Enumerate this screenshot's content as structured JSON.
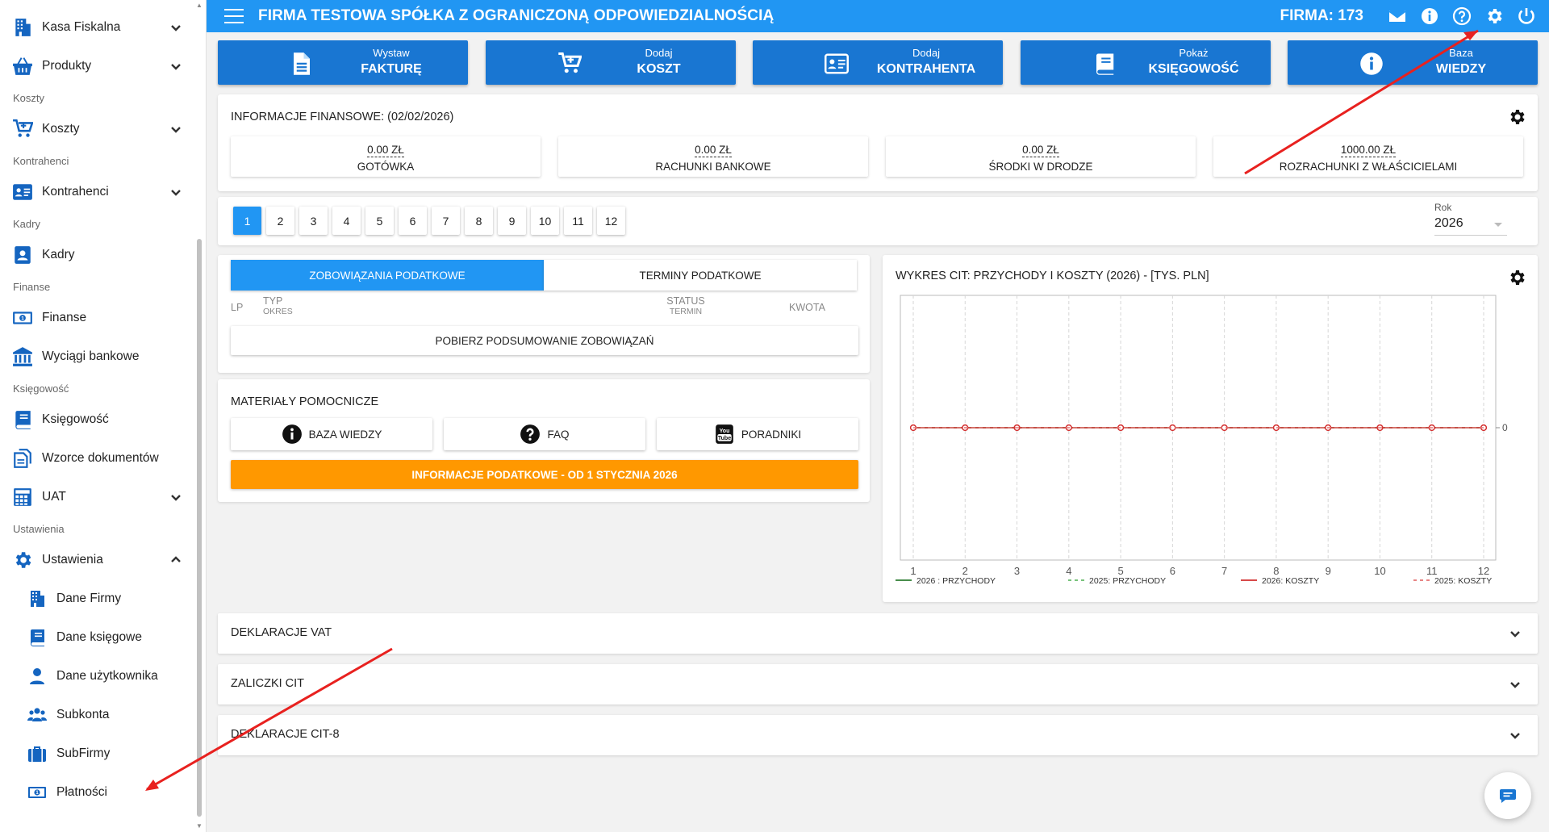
{
  "sidebar": {
    "items": [
      {
        "type": "item",
        "label": "Kasa Fiskalna",
        "icon": "building-icon",
        "chevron": "down"
      },
      {
        "type": "item",
        "label": "Produkty",
        "icon": "basket-icon",
        "chevron": "down"
      },
      {
        "type": "section",
        "label": "Koszty"
      },
      {
        "type": "item",
        "label": "Koszty",
        "icon": "cart-plus-icon",
        "chevron": "down"
      },
      {
        "type": "section",
        "label": "Kontrahenci"
      },
      {
        "type": "item",
        "label": "Kontrahenci",
        "icon": "id-card-icon",
        "chevron": "down"
      },
      {
        "type": "section",
        "label": "Kadry"
      },
      {
        "type": "item",
        "label": "Kadry",
        "icon": "user-badge-icon",
        "chevron": ""
      },
      {
        "type": "section",
        "label": "Finanse"
      },
      {
        "type": "item",
        "label": "Finanse",
        "icon": "money-bill-icon",
        "chevron": ""
      },
      {
        "type": "item",
        "label": "Wyciągi bankowe",
        "icon": "bank-icon",
        "chevron": ""
      },
      {
        "type": "section",
        "label": "Księgowość"
      },
      {
        "type": "item",
        "label": "Księgowość",
        "icon": "book-icon",
        "chevron": ""
      },
      {
        "type": "item",
        "label": "Wzorce dokumentów",
        "icon": "documents-icon",
        "chevron": ""
      },
      {
        "type": "item",
        "label": "UAT",
        "icon": "calculator-icon",
        "chevron": "down"
      },
      {
        "type": "section",
        "label": "Ustawienia"
      },
      {
        "type": "item",
        "label": "Ustawienia",
        "icon": "gear-icon",
        "chevron": "up"
      },
      {
        "type": "sub",
        "label": "Dane Firmy",
        "icon": "building-icon"
      },
      {
        "type": "sub",
        "label": "Dane księgowe",
        "icon": "book-icon"
      },
      {
        "type": "sub",
        "label": "Dane użytkownika",
        "icon": "user-icon"
      },
      {
        "type": "sub",
        "label": "Subkonta",
        "icon": "users-icon"
      },
      {
        "type": "sub",
        "label": "SubFirmy",
        "icon": "briefcase-icon"
      },
      {
        "type": "sub",
        "label": "Płatności",
        "icon": "money-bill-icon"
      }
    ]
  },
  "topbar": {
    "title": "FIRMA TESTOWA SPÓŁKA Z OGRANICZONĄ ODPOWIEDZIALNOŚCIĄ",
    "firma": "FIRMA: 173",
    "icons": [
      "envelope-icon",
      "info-icon",
      "help-icon",
      "gear-icon",
      "power-icon"
    ]
  },
  "actions": [
    {
      "small": "Wystaw",
      "big": "FAKTURĘ",
      "icon": "file-icon"
    },
    {
      "small": "Dodaj",
      "big": "KOSZT",
      "icon": "cart-plus-icon"
    },
    {
      "small": "Dodaj",
      "big": "KONTRAHENTA",
      "icon": "id-card-icon"
    },
    {
      "small": "Pokaż",
      "big": "KSIĘGOWOŚĆ",
      "icon": "book-icon"
    },
    {
      "small": "Baza",
      "big": "WIEDZY",
      "icon": "info-icon"
    }
  ],
  "finance": {
    "title": "INFORMACJE FINANSOWE: (02/02/2026)",
    "boxes": [
      {
        "value": "0.00 ZŁ",
        "label": "GOTÓWKA"
      },
      {
        "value": "0.00 ZŁ",
        "label": "RACHUNKI BANKOWE"
      },
      {
        "value": "0.00 ZŁ",
        "label": "ŚRODKI W DRODZE"
      },
      {
        "value": "1000.00 ZŁ",
        "label": "ROZRACHUNKI Z WŁAŚCICIELAMI"
      }
    ]
  },
  "months": [
    "1",
    "2",
    "3",
    "4",
    "5",
    "6",
    "7",
    "8",
    "9",
    "10",
    "11",
    "12"
  ],
  "active_month": "1",
  "year": {
    "label": "Rok",
    "value": "2026"
  },
  "tax": {
    "tabs": [
      "ZOBOWIĄZANIA PODATKOWE",
      "TERMINY PODATKOWE"
    ],
    "active_tab": 0,
    "headers": {
      "lp": "LP",
      "typ": "TYP",
      "okres": "OKRES",
      "status": "STATUS",
      "termin": "TERMIN",
      "kwota": "KWOTA"
    },
    "summary_button": "POBIERZ PODSUMOWANIE ZOBOWIĄZAŃ"
  },
  "materials": {
    "title": "MATERIAŁY POMOCNICZE",
    "buttons": [
      {
        "label": "BAZA WIEDZY",
        "icon": "info-icon"
      },
      {
        "label": "FAQ",
        "icon": "question-icon"
      },
      {
        "label": "PORADNIKI",
        "icon": "youtube-icon"
      }
    ],
    "orange_button": "INFORMACJE PODATKOWE - OD 1 STYCZNIA 2026"
  },
  "chart_data": {
    "type": "line",
    "title": "WYKRES CIT: PRZYCHODY I KOSZTY (2026) - [TYS. PLN]",
    "x": [
      1,
      2,
      3,
      4,
      5,
      6,
      7,
      8,
      9,
      10,
      11,
      12
    ],
    "series": [
      {
        "name": "2026 : PRZYCHODY",
        "values": [
          0,
          0,
          0,
          0,
          0,
          0,
          0,
          0,
          0,
          0,
          0,
          0
        ],
        "color": "#2e7d32",
        "dash": false
      },
      {
        "name": "2025: PRZYCHODY",
        "values": [
          0,
          0,
          0,
          0,
          0,
          0,
          0,
          0,
          0,
          0,
          0,
          0
        ],
        "color": "#66bb6a",
        "dash": true
      },
      {
        "name": "2026: KOSZTY",
        "values": [
          0,
          0,
          0,
          0,
          0,
          0,
          0,
          0,
          0,
          0,
          0,
          0
        ],
        "color": "#d32f2f",
        "dash": false
      },
      {
        "name": "2025: KOSZTY",
        "values": [
          0,
          0,
          0,
          0,
          0,
          0,
          0,
          0,
          0,
          0,
          0,
          0
        ],
        "color": "#e57373",
        "dash": true
      }
    ],
    "y_ticks": [
      "0"
    ],
    "ylim": [
      -1,
      1
    ],
    "grid": true,
    "legend": "bottom"
  },
  "accordions": [
    "DEKLARACJE VAT",
    "ZALICZKI CIT",
    "DEKLARACJE CIT-8"
  ],
  "colors": {
    "primary": "#2196f3",
    "button": "#1976d2",
    "orange": "#ff9800",
    "annotation": "#e8211f"
  }
}
